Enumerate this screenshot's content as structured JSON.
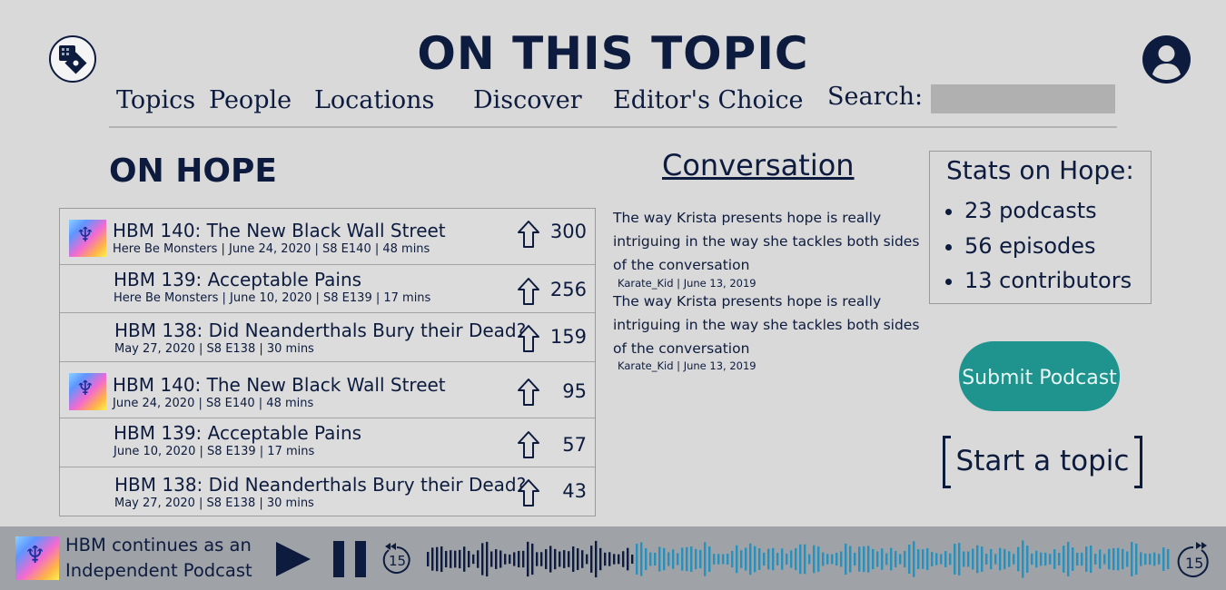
{
  "header": {
    "site_title": "ON THIS TOPIC",
    "nav": [
      "Topics",
      "People",
      "Locations",
      "Discover",
      "Editor's Choice"
    ],
    "search_label": "Search:",
    "search_value": ""
  },
  "page": {
    "heading": "ON HOPE"
  },
  "episodes": [
    {
      "title": "HBM 140: The New Black Wall Street",
      "meta": "Here Be Monsters | June 24, 2020 | S8 E140 | 48 mins",
      "votes": "300",
      "thumb": true
    },
    {
      "title": "HBM 139: Acceptable Pains",
      "meta": "Here Be Monsters | June 10, 2020 | S8 E139 | 17 mins",
      "votes": "256",
      "thumb": false
    },
    {
      "title": "HBM 138: Did Neanderthals Bury their Dead?",
      "meta": "May 27, 2020 | S8 E138 | 30 mins",
      "votes": "159",
      "thumb": false
    },
    {
      "title": "HBM 140: The New Black Wall Street",
      "meta": "June 24, 2020 | S8 E140 | 48 mins",
      "votes": "95",
      "thumb": true
    },
    {
      "title": "HBM 139: Acceptable Pains",
      "meta": "June 10, 2020 | S8 E139 | 17 mins",
      "votes": "57",
      "thumb": false
    },
    {
      "title": "HBM 138: Did Neanderthals Bury their Dead?",
      "meta": "May 27, 2020 | S8 E138 | 30 mins",
      "votes": "43",
      "thumb": false
    }
  ],
  "conversation": {
    "heading": "Conversation",
    "comments": [
      {
        "text": "The way Krista presents hope is really intriguing in the way she tackles both sides of the conversation",
        "author": "Karate_Kid",
        "date": "June 13, 2019",
        "meta": "Karate_Kid | June 13, 2019"
      },
      {
        "text": "The way Krista presents hope is really intriguing in the way she tackles both sides of the conversation",
        "author": "Karate_Kid",
        "date": "June 13, 2019",
        "meta": "Karate_Kid | June 13, 2019"
      }
    ]
  },
  "stats": {
    "title": "Stats on Hope:",
    "items": [
      "23 podcasts",
      "56 episodes",
      "13 contributors"
    ]
  },
  "actions": {
    "submit_podcast": "Submit Podcast",
    "start_topic": "Start a topic"
  },
  "player": {
    "now_playing": "HBM continues as an Independent Podcast",
    "skip_back_seconds": "15",
    "skip_forward_seconds": "15",
    "progress": 0.28,
    "icons": [
      "play-icon",
      "pause-icon",
      "skip-back-15-icon",
      "skip-forward-15-icon"
    ]
  },
  "colors": {
    "text": "#0d1b3e",
    "background": "#d9d9d9",
    "accent": "#1f948e",
    "player_bar": "#9fa3a8",
    "waveform_played": "#0d1b3e",
    "waveform_remaining": "#2491bf"
  }
}
